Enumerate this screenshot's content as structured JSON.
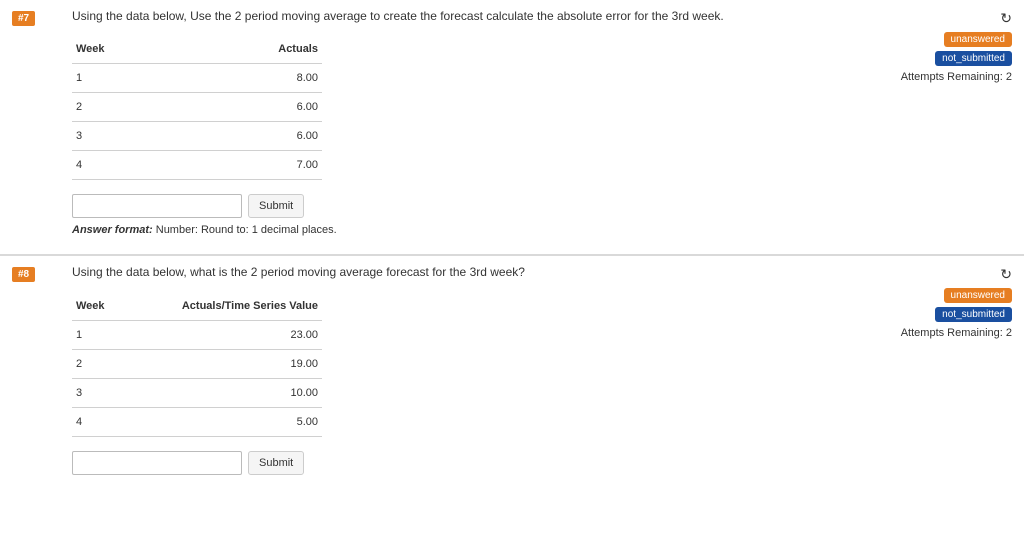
{
  "q7": {
    "number": "#7",
    "prompt": "Using the data below, Use the 2 period moving average to create the forecast calculate the absolute error for the 3rd week.",
    "table_header_week": "Week",
    "table_header_value": "Actuals",
    "rows": [
      {
        "week": "1",
        "value": "8.00"
      },
      {
        "week": "2",
        "value": "6.00"
      },
      {
        "week": "3",
        "value": "6.00"
      },
      {
        "week": "4",
        "value": "7.00"
      }
    ],
    "submit_label": "Submit",
    "answer_format_label": "Answer format:",
    "answer_format_text": " Number: Round to: 1 decimal places.",
    "status": {
      "badge_unanswered": "unanswered",
      "badge_notsubmitted": "not_submitted",
      "attempts": "Attempts Remaining: 2"
    }
  },
  "q8": {
    "number": "#8",
    "prompt": "Using the data below, what is the 2 period moving average forecast for the 3rd week?",
    "table_header_week": "Week",
    "table_header_value": "Actuals/Time Series Value",
    "rows": [
      {
        "week": "1",
        "value": "23.00"
      },
      {
        "week": "2",
        "value": "19.00"
      },
      {
        "week": "3",
        "value": "10.00"
      },
      {
        "week": "4",
        "value": "5.00"
      }
    ],
    "submit_label": "Submit",
    "status": {
      "badge_unanswered": "unanswered",
      "badge_notsubmitted": "not_submitted",
      "attempts": "Attempts Remaining: 2"
    }
  }
}
